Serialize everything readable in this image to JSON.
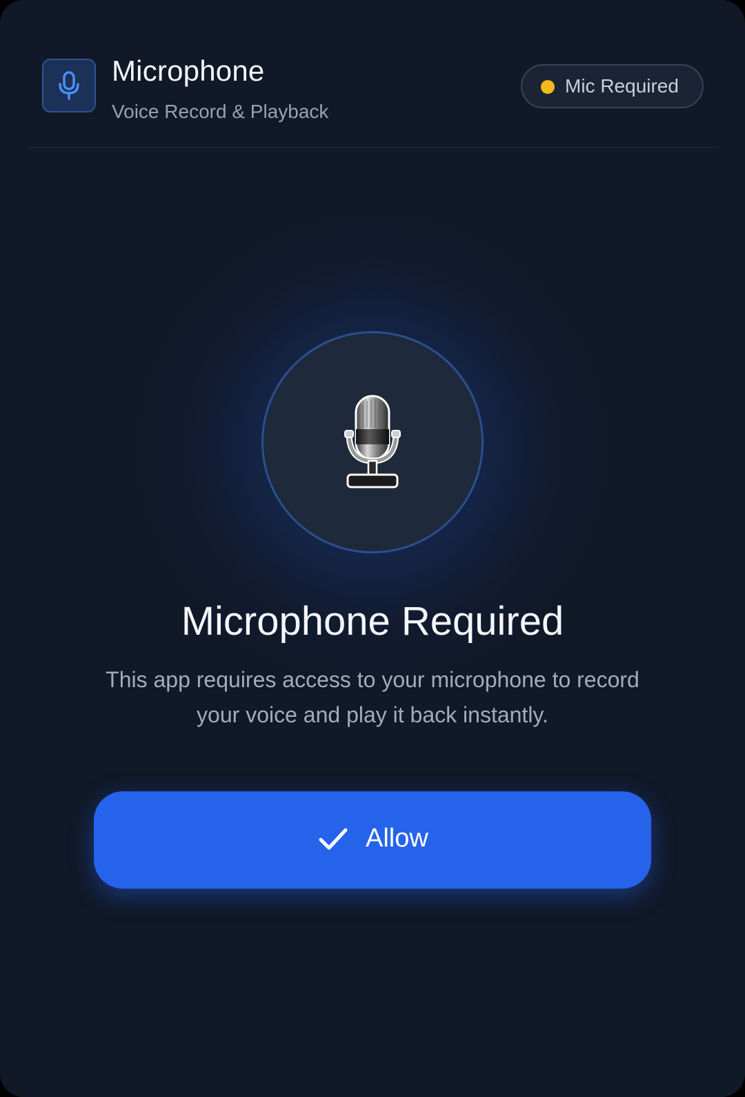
{
  "header": {
    "title": "Microphone",
    "subtitle": "Voice Record & Playback",
    "app_icon": "microphone-icon",
    "status_badge": {
      "label": "Mic Required",
      "dot_color": "#f5b819"
    }
  },
  "main": {
    "hero_icon": "studio-microphone-icon",
    "title": "Microphone Required",
    "description": "This app requires access to your microphone to record your voice and play it back instantly."
  },
  "actions": {
    "allow_label": "Allow",
    "allow_icon": "checkmark-icon"
  },
  "colors": {
    "background": "#111827",
    "accent": "#2563eb",
    "status_dot": "#f5b819"
  }
}
